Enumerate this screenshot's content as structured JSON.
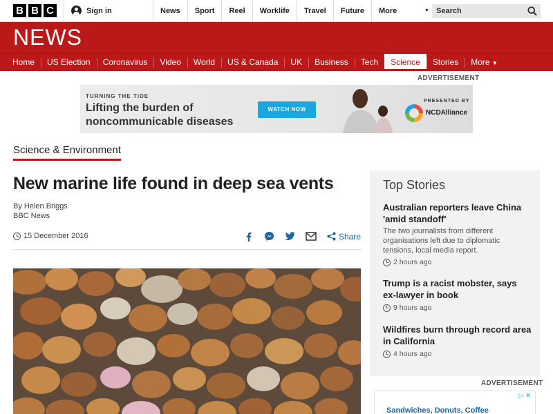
{
  "topbar": {
    "logo_letters": [
      "B",
      "B",
      "C"
    ],
    "signin_label": "Sign in",
    "nav": [
      "News",
      "Sport",
      "Reel",
      "Worklife",
      "Travel",
      "Future"
    ],
    "more_label": "More",
    "search_placeholder": "Search"
  },
  "banner": {
    "title": "NEWS",
    "nav": [
      "Home",
      "US Election",
      "Coronavirus",
      "Video",
      "World",
      "US & Canada",
      "UK",
      "Business",
      "Tech",
      "Science",
      "Stories"
    ],
    "active_item": "Science",
    "more_label": "More"
  },
  "ad_top": {
    "label": "ADVERTISEMENT",
    "eyebrow": "TURNING THE TIDE",
    "headline": "Lifting the burden of noncommunicable diseases",
    "cta": "WATCH NOW",
    "presented_by": "PRESENTED BY",
    "sponsor": "NCDAlliance"
  },
  "section_link": "Science & Environment",
  "article": {
    "headline": "New marine life found in deep sea vents",
    "author": "By Helen Briggs",
    "outlet": "BBC News",
    "date": "15 December 2016",
    "share_label": "Share"
  },
  "top_stories": {
    "title": "Top Stories",
    "stories": [
      {
        "title": "Australian reporters leave China 'amid standoff'",
        "summary": "The two journalists from different organisations left due to diplomatic tensions, local media report.",
        "time": "2 hours ago"
      },
      {
        "title": "Trump is a racist mobster, says ex-lawyer in book",
        "summary": "",
        "time": "9 hours ago"
      },
      {
        "title": "Wildfires burn through record area in California",
        "summary": "",
        "time": "4 hours ago"
      }
    ]
  },
  "ad_bottom": {
    "label": "ADVERTISEMENT",
    "text": "Sandwiches, Donuts, Coffee"
  },
  "colors": {
    "brand_red": "#bb1919",
    "link_blue": "#1a66a6"
  }
}
